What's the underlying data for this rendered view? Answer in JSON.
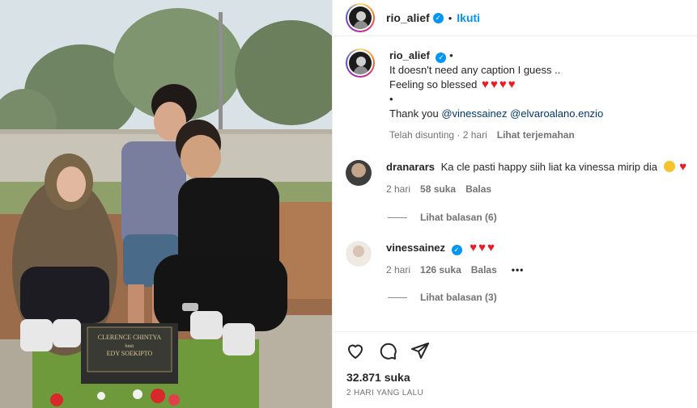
{
  "post": {
    "author": "rio_alief",
    "follow_label": "Ikuti",
    "separator": "•",
    "verified_mark": "✓",
    "caption_line1": "It doesn't need any caption I guess ..",
    "caption_line2": "Feeling so blessed",
    "caption_bullet": "•",
    "caption_thanks": "Thank you",
    "mention1": "@vinessainez",
    "mention2": "@elvaroalano.enzio",
    "caption_edited": "Telah disunting · 2 hari",
    "see_translation": "Lihat terjemahan",
    "like_count": "32.871 suka",
    "posted": "2 HARI YANG LALU"
  },
  "comments": [
    {
      "user": "dranarars",
      "text": "Ka cle pasti happy siih liat ka vinessa mirip dia",
      "time": "2 hari",
      "likes": "58 suka",
      "reply": "Balas",
      "view_replies": "Lihat balasan (6)"
    },
    {
      "user": "vinessainez",
      "time": "2 hari",
      "likes": "126 suka",
      "reply": "Balas",
      "options": "•••",
      "view_replies": "Lihat balasan (3)"
    }
  ],
  "plaque": {
    "line1": "CLERENCE CHINTYA",
    "line2": "binti",
    "line3": "EDY SOEKIPTO"
  },
  "icons": [
    "heart-icon",
    "comment-icon",
    "share-icon",
    "verified-icon",
    "more-options-icon"
  ],
  "colors": {
    "accent": "#0095f6",
    "heart": "#ed1c24",
    "text": "#262626",
    "muted": "#737373"
  }
}
